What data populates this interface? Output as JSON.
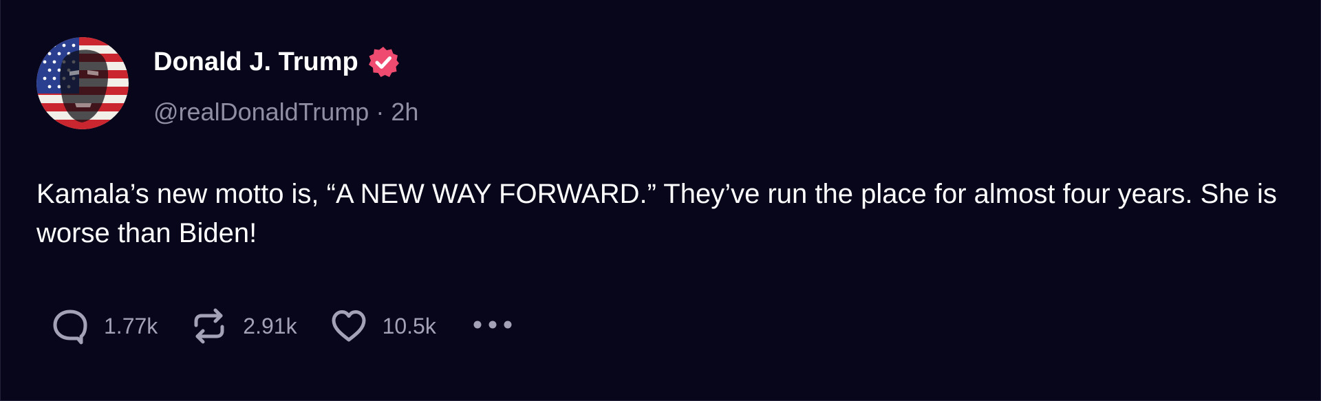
{
  "post": {
    "author": {
      "name": "Donald J. Trump",
      "handle": "@realDonaldTrump",
      "separator": "·",
      "time": "2h",
      "verified_color": "#ef4a6f"
    },
    "text": "Kamala’s new motto is, “A NEW WAY FORWARD.” They’ve run the place for almost four years. She is worse than Biden!",
    "actions": {
      "replies": "1.77k",
      "reposts": "2.91k",
      "likes": "10.5k"
    }
  },
  "icons": {
    "reply": "speech-bubble-icon",
    "repost": "repost-arrows-icon",
    "like": "heart-icon",
    "more": "more-dots-icon",
    "verified": "verified-check-icon"
  },
  "colors": {
    "background": "#07061a",
    "text": "#ffffff",
    "muted": "#8f8ea3",
    "icon": "#a3a2b6",
    "verified": "#ef4a6f"
  }
}
